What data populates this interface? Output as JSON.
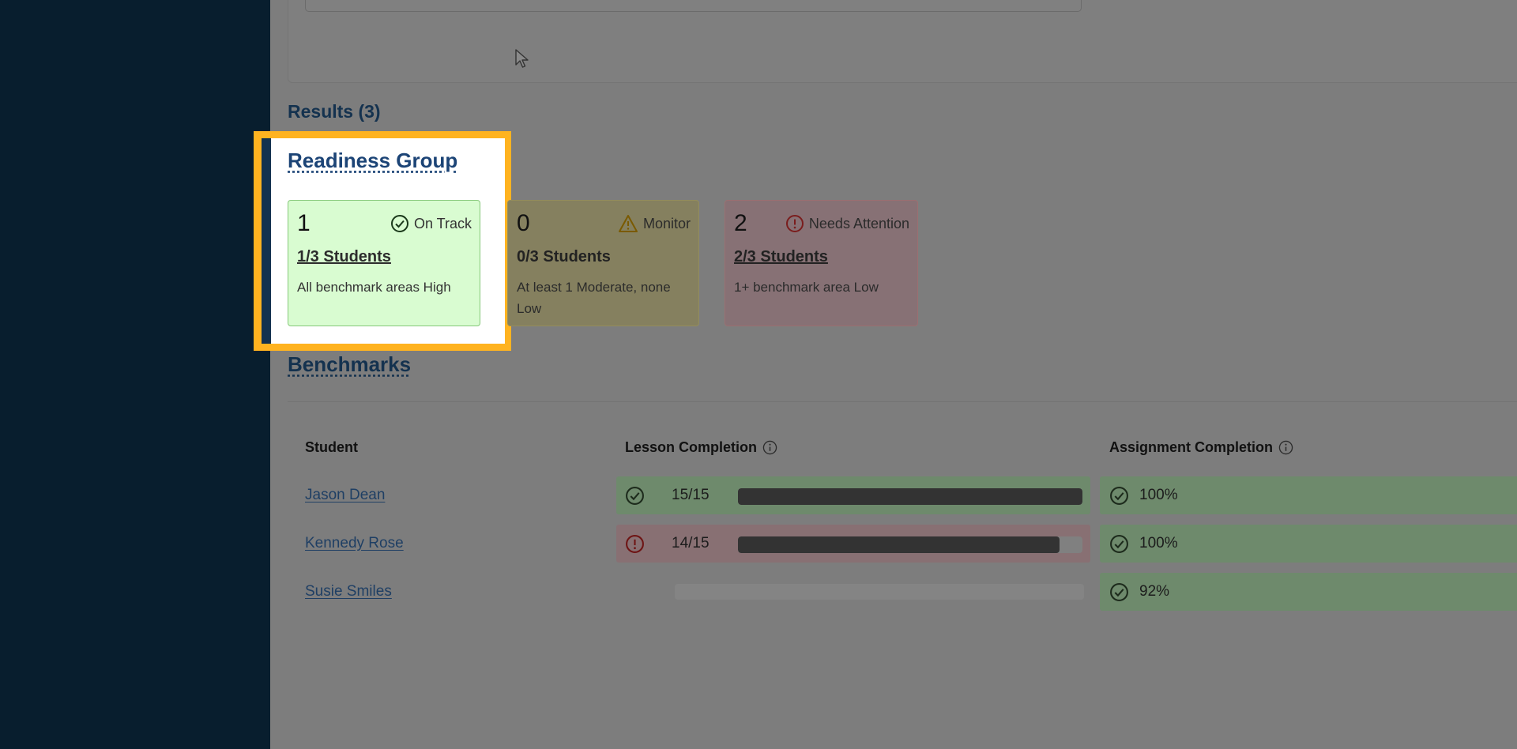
{
  "results": {
    "title": "Results (3)"
  },
  "readiness_group": {
    "title": "Readiness Group",
    "cards": [
      {
        "number": "1",
        "status": "On Track",
        "count": "1/3 Students",
        "description": "All benchmark areas High",
        "icon": "check-circle-icon",
        "color": "#d9fcd1"
      },
      {
        "number": "0",
        "status": "Monitor",
        "count": "0/3 Students",
        "description": "At least 1 Moderate, none Low",
        "icon": "warning-triangle-icon",
        "color": "#fff3b8"
      },
      {
        "number": "2",
        "status": "Needs Attention",
        "count": "2/3 Students",
        "description": "1+ benchmark area Low",
        "icon": "alert-circle-icon",
        "color": "#ffd9dc"
      }
    ]
  },
  "benchmarks": {
    "title": "Benchmarks",
    "headers": {
      "student": "Student",
      "lesson": "Lesson Completion",
      "assignment": "Assignment Completion"
    },
    "rows": [
      {
        "name": "Jason Dean",
        "lesson_status": "on-track",
        "lesson_fraction": "15/15",
        "lesson_progress": 1.0,
        "assignment": "100%"
      },
      {
        "name": "Kennedy Rose",
        "lesson_status": "needs-attention",
        "lesson_fraction": "14/15",
        "lesson_progress": 0.9333,
        "assignment": "100%"
      },
      {
        "name": "Susie Smiles",
        "lesson_status": "none",
        "lesson_fraction": "",
        "lesson_progress": 0,
        "assignment": "92%"
      }
    ]
  },
  "colors": {
    "sidebar": "#081e2e",
    "highlight": "#ffb320",
    "link": "#1c4476",
    "success": "#2e7d32",
    "danger": "#c62828",
    "warning": "#d49a00"
  }
}
